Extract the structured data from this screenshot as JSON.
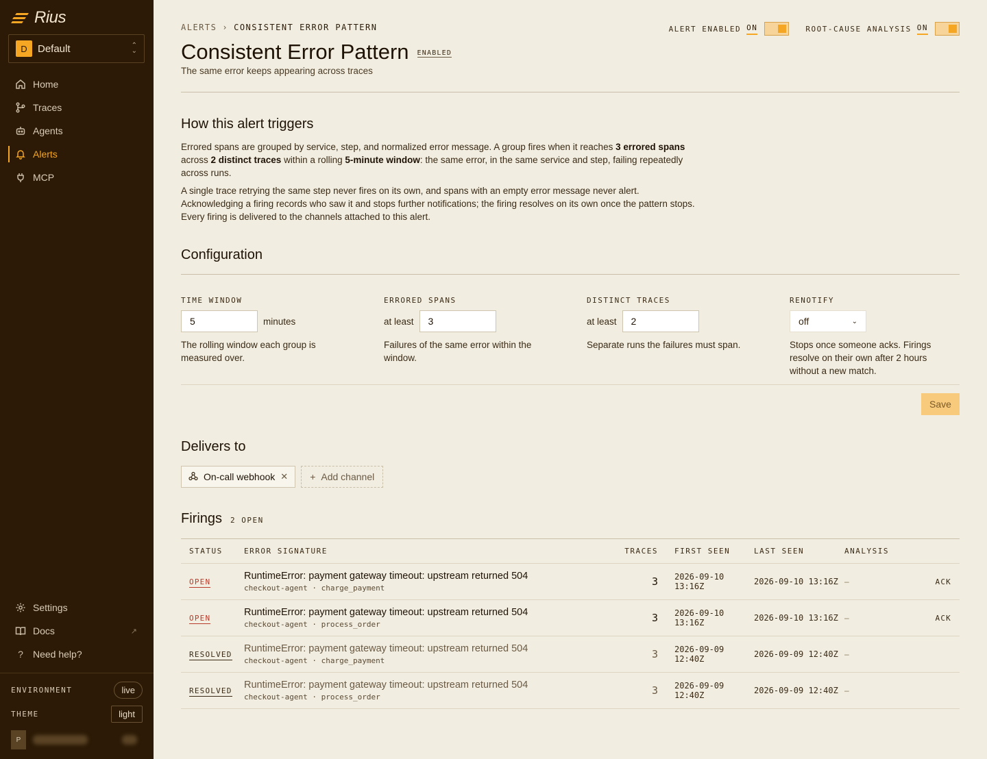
{
  "brand": {
    "name": "Rius",
    "accent": "#f5a623",
    "sidebar_bg": "#2c1a06",
    "page_bg": "#f1ede0"
  },
  "workspace": {
    "badge": "D",
    "name": "Default"
  },
  "nav": [
    {
      "label": "Home",
      "icon": "home-icon"
    },
    {
      "label": "Traces",
      "icon": "traces-icon"
    },
    {
      "label": "Agents",
      "icon": "agents-icon"
    },
    {
      "label": "Alerts",
      "icon": "bell-icon",
      "active": true
    },
    {
      "label": "MCP",
      "icon": "plug-icon"
    }
  ],
  "nav_bottom": [
    {
      "label": "Settings",
      "icon": "gear-icon"
    },
    {
      "label": "Docs",
      "icon": "book-icon"
    },
    {
      "label": "Need help?",
      "icon": "help-icon"
    }
  ],
  "environment": {
    "label": "ENVIRONMENT",
    "value": "live"
  },
  "theme": {
    "label": "THEME",
    "value": "light"
  },
  "user": {
    "initial": "P"
  },
  "breadcrumb": {
    "root": "ALERTS",
    "sep": "›",
    "current": "CONSISTENT ERROR PATTERN"
  },
  "toggles": {
    "alert_enabled": {
      "label": "ALERT ENABLED",
      "state": "ON"
    },
    "rca": {
      "label": "ROOT-CAUSE ANALYSIS",
      "state": "ON"
    }
  },
  "page": {
    "title": "Consistent Error Pattern",
    "status_badge": "ENABLED",
    "subtitle": "The same error keeps appearing across traces"
  },
  "how": {
    "heading": "How this alert triggers",
    "p1": [
      {
        "t": "Errored spans are grouped by service, step, and normalized error message. A group fires when it reaches "
      },
      {
        "b": "3 errored spans"
      },
      {
        "t": " across "
      },
      {
        "b": "2 distinct traces"
      },
      {
        "t": " within a rolling "
      },
      {
        "b": "5-minute window"
      },
      {
        "t": ": the same error, in the same service and step, failing repeatedly across runs."
      }
    ],
    "p2": "A single trace retrying the same step never fires on its own, and spans with an empty error message never alert. Acknowledging a firing records who saw it and stops further notifications; the firing resolves on its own once the pattern stops. Every firing is delivered to the channels attached to this alert."
  },
  "config": {
    "heading": "Configuration",
    "time_window": {
      "label": "TIME WINDOW",
      "value": "5",
      "unit": "minutes",
      "help": "The rolling window each group is measured over."
    },
    "errored_spans": {
      "label": "ERRORED SPANS",
      "prefix": "at least",
      "value": "3",
      "help": "Failures of the same error within the window."
    },
    "distinct_traces": {
      "label": "DISTINCT TRACES",
      "prefix": "at least",
      "value": "2",
      "help": "Separate runs the failures must span."
    },
    "renotify": {
      "label": "RENOTIFY",
      "value": "off",
      "help": "Stops once someone acks. Firings resolve on their own after 2 hours without a new match."
    },
    "save_label": "Save"
  },
  "delivers": {
    "heading": "Delivers to",
    "channels": [
      {
        "label": "On-call webhook",
        "icon": "webhook-icon"
      }
    ],
    "add_label": "Add channel"
  },
  "firings": {
    "heading": "Firings",
    "count": "2 OPEN",
    "columns": [
      "STATUS",
      "ERROR SIGNATURE",
      "TRACES",
      "FIRST SEEN",
      "LAST SEEN",
      "ANALYSIS"
    ],
    "rows": [
      {
        "status": "OPEN",
        "signature": "RuntimeError: payment gateway timeout: upstream returned 504",
        "agent": "checkout-agent",
        "step": "charge_payment",
        "traces": "3",
        "first_seen": "2026-09-10 13:16Z",
        "last_seen": "2026-09-10 13:16Z",
        "analysis": "–",
        "action": "ACK"
      },
      {
        "status": "OPEN",
        "signature": "RuntimeError: payment gateway timeout: upstream returned 504",
        "agent": "checkout-agent",
        "step": "process_order",
        "traces": "3",
        "first_seen": "2026-09-10 13:16Z",
        "last_seen": "2026-09-10 13:16Z",
        "analysis": "–",
        "action": "ACK"
      },
      {
        "status": "RESOLVED",
        "signature": "RuntimeError: payment gateway timeout: upstream returned 504",
        "agent": "checkout-agent",
        "step": "charge_payment",
        "traces": "3",
        "first_seen": "2026-09-09 12:40Z",
        "last_seen": "2026-09-09 12:40Z",
        "analysis": "–",
        "action": ""
      },
      {
        "status": "RESOLVED",
        "signature": "RuntimeError: payment gateway timeout: upstream returned 504",
        "agent": "checkout-agent",
        "step": "process_order",
        "traces": "3",
        "first_seen": "2026-09-09 12:40Z",
        "last_seen": "2026-09-09 12:40Z",
        "analysis": "–",
        "action": ""
      }
    ]
  }
}
